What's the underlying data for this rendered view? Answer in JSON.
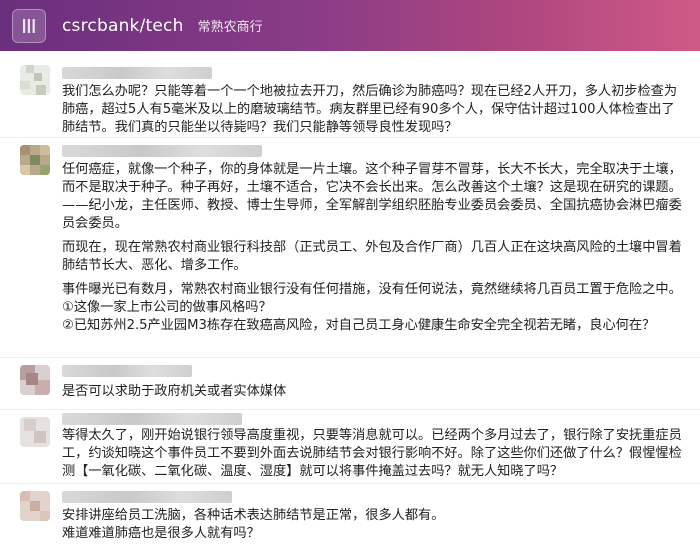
{
  "header": {
    "channel_name": "csrcbank/tech",
    "channel_sub": "常熟农商行"
  },
  "posts": [
    {
      "lines": [
        "我们怎么办呢？只能等着一个一个地被拉去开刀，然后确诊为肺癌吗？现在已经2人开刀，多人初步检查为肺癌，超过5人有5毫米及以上的磨玻璃结节。病友群里已经有90多个人，保守估计超过100人体检查出了肺结节。我们真的只能坐以待毙吗？我们只能静等领导良性发现吗？"
      ]
    },
    {
      "lines": [
        "任何癌症，就像一个种子，你的身体就是一片土壤。这个种子冒芽不冒芽，长大不长大，完全取决于土壤，而不是取决于种子。种子再好，土壤不适合，它决不会长出来。怎么改善这个土壤？这是现在研究的课题。——纪小龙，主任医师、教授、博士生导师，全军解剖学组织胚胎专业委员会委员、全国抗癌协会淋巴瘤委员会委员。",
        "而现在，现在常熟农村商业银行科技部（正式员工、外包及合作厂商）几百人正在这块高风险的土壤中冒着肺结节长大、恶化、增多工作。",
        "事件曝光已有数月，常熟农村商业银行没有任何措施，没有任何说法，竟然继续将几百员工置于危险之中。"
      ],
      "list": [
        "①这像一家上市公司的做事风格吗？",
        "②已知苏州2.5产业园M3栋存在致癌高风险，对自己员工身心健康生命安全完全视若无睹，良心何在？"
      ]
    },
    {
      "lines": [
        "是否可以求助于政府机关或者实体媒体"
      ]
    },
    {
      "lines": [
        "等得太久了，刚开始说银行领导高度重视，只要等消息就可以。已经两个多月过去了，银行除了安抚重症员工，约谈知晓这个事件员工不要到外面去说肺结节会对银行影响不好。除了这些你们还做了什么？假惺惺检测【一氧化碳、二氧化碳、温度、湿度】就可以将事件掩盖过去吗？就无人知晓了吗？"
      ]
    },
    {
      "lines": [
        "安排讲座给员工洗脑，各种话术表达肺结节是正常，很多人都有。",
        "难道难道肺癌也是很多人就有吗？"
      ]
    }
  ],
  "icons": {
    "logo": "channel-logo-icon"
  },
  "colors": {
    "header_start": "#6a2f7d",
    "header_end": "#cf5a86",
    "text": "#222222"
  }
}
